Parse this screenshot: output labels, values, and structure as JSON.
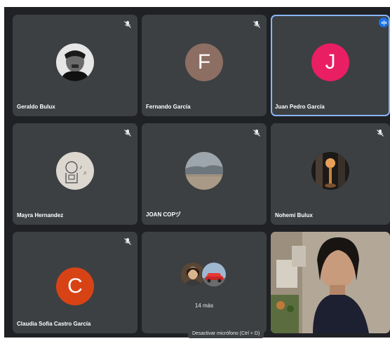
{
  "participants": [
    {
      "name": "Geraldo Bulux",
      "avatar": "photo-person"
    },
    {
      "name": "Fernando García",
      "avatar": "letter",
      "letter": "F",
      "color": "#8d6e63"
    },
    {
      "name": "Juan Pedro García",
      "avatar": "letter",
      "letter": "J",
      "color": "#e91e63",
      "speaking": true
    },
    {
      "name": "Mayra Hernandez",
      "avatar": "photo-drawing"
    },
    {
      "name": "JOAN COPヅ",
      "avatar": "photo-landscape"
    },
    {
      "name": "Nohemi Bulux",
      "avatar": "photo-lamp"
    },
    {
      "name": "Claudia Sofia Castro García",
      "avatar": "letter",
      "letter": "C",
      "color": "#d84315"
    },
    {
      "more_label": "14 más"
    },
    {
      "name": "",
      "video": true
    }
  ],
  "tooltip": "Desactivar micrófono (Ctrl + D)",
  "colors": {
    "background": "#202124",
    "tile": "#3c4043",
    "active_border": "#8ab4f8",
    "speaking": "#1a73e8"
  }
}
